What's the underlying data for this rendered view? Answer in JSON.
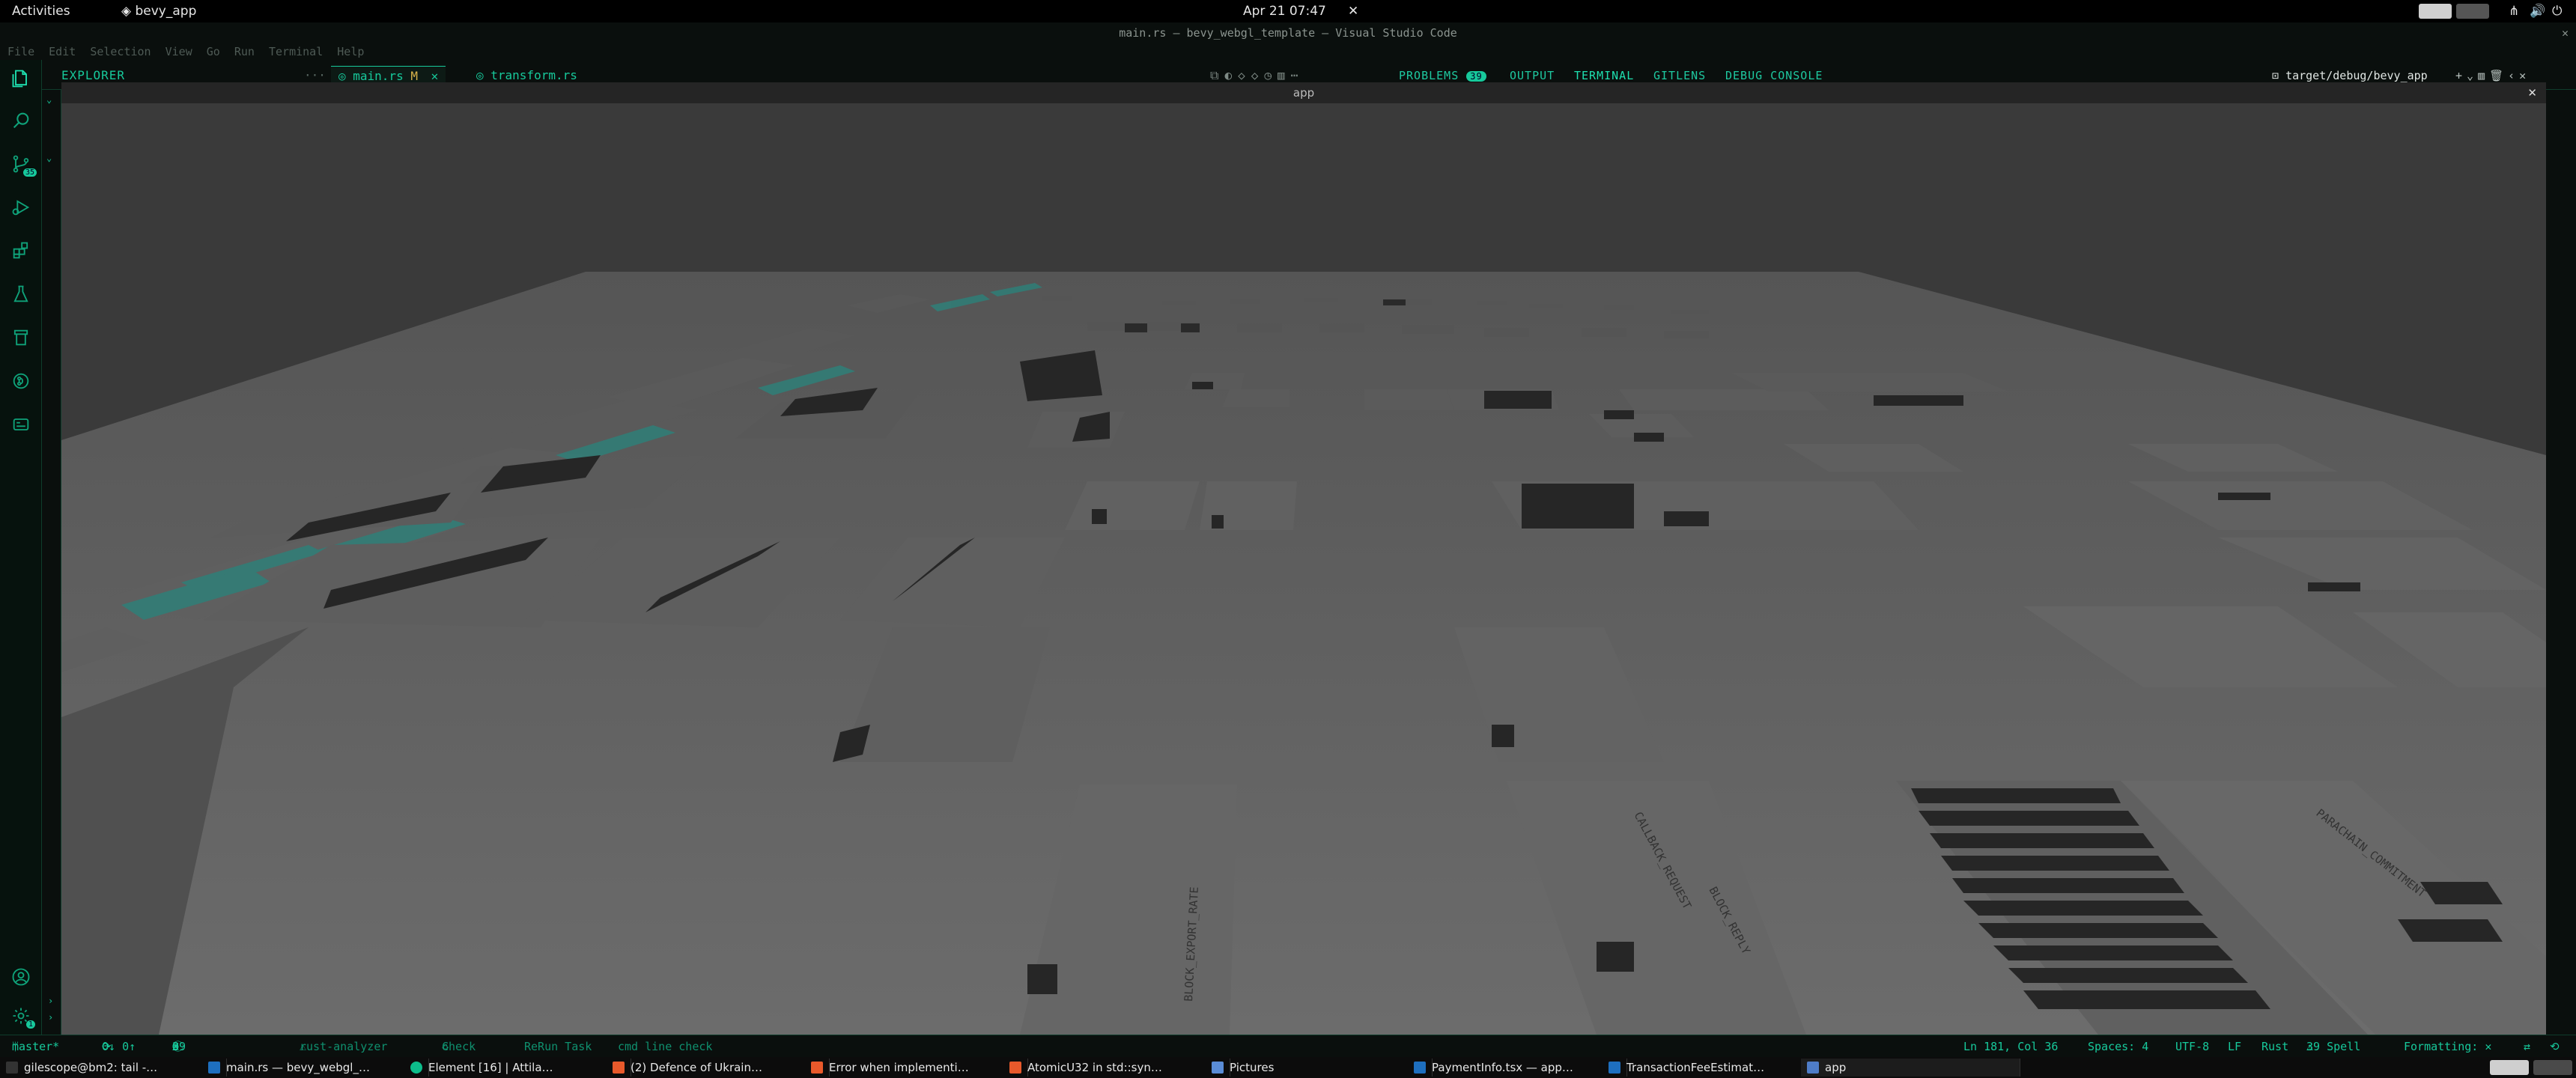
{
  "topbar": {
    "activities": "Activities",
    "app_name": "bevy_app",
    "clock": "Apr 21 07:47"
  },
  "window": {
    "title": "main.rs — bevy_webgl_template — Visual Studio Code"
  },
  "menu": [
    "File",
    "Edit",
    "Selection",
    "View",
    "Go",
    "Run",
    "Terminal",
    "Help"
  ],
  "activity_badges": {
    "source_control": "35",
    "accounts": "1"
  },
  "sidebar": {
    "title": "EXPLORER",
    "more": "···"
  },
  "editor_tabs": [
    {
      "label": "main.rs",
      "modified": "M"
    },
    {
      "label": "transform.rs"
    }
  ],
  "panel": {
    "tabs": [
      "PROBLEMS",
      "OUTPUT",
      "TERMINAL",
      "GITLENS",
      "DEBUG CONSOLE"
    ],
    "problems_count": "39",
    "terminal_name": "target/debug/bevy_app"
  },
  "app_window": {
    "title": "app"
  },
  "status": {
    "branch": "master*",
    "sync": "0↓ 0↑",
    "errors": "0",
    "warnings": "0",
    "infos": "39",
    "analyzer": "rust-analyzer",
    "check": "Check",
    "rerun": "ReRun Task",
    "cmd_line": "cmd line check",
    "position": "Ln 181, Col 36",
    "spaces": "Spaces: 4",
    "encoding": "UTF-8",
    "eol": "LF",
    "language": "Rust",
    "spell": "39 Spell",
    "formatting": "Formatting: ✕"
  },
  "scene_labels": [
    "BLOCK_EXPORT_RATE",
    "CALLBACK_REQUEST",
    "BLOCK_REPLY",
    "PARACHAIN_COMMITMENT"
  ],
  "taskbar": [
    {
      "label": "gilescope@bm2: tail -…",
      "icon": "terminal-icon"
    },
    {
      "label": "main.rs — bevy_webgl_…",
      "icon": "vscode-icon"
    },
    {
      "label": "Element [16] | Attila…",
      "icon": "element-icon"
    },
    {
      "label": "(2) Defence of Ukrain…",
      "icon": "brave-icon"
    },
    {
      "label": "Error when implementi…",
      "icon": "brave-icon"
    },
    {
      "label": "AtomicU32 in std::syn…",
      "icon": "brave-icon"
    },
    {
      "label": "Pictures",
      "icon": "folder-icon"
    },
    {
      "label": "PaymentInfo.tsx — app…",
      "icon": "vscode-icon"
    },
    {
      "label": "TransactionFeeEstimat…",
      "icon": "vscode-icon"
    },
    {
      "label": "app",
      "icon": "bevy-icon"
    }
  ],
  "colors": {
    "accent": "#17c99b",
    "scene_floor": "#6b6b6b",
    "cyan_blocks": "#2f7f78"
  }
}
